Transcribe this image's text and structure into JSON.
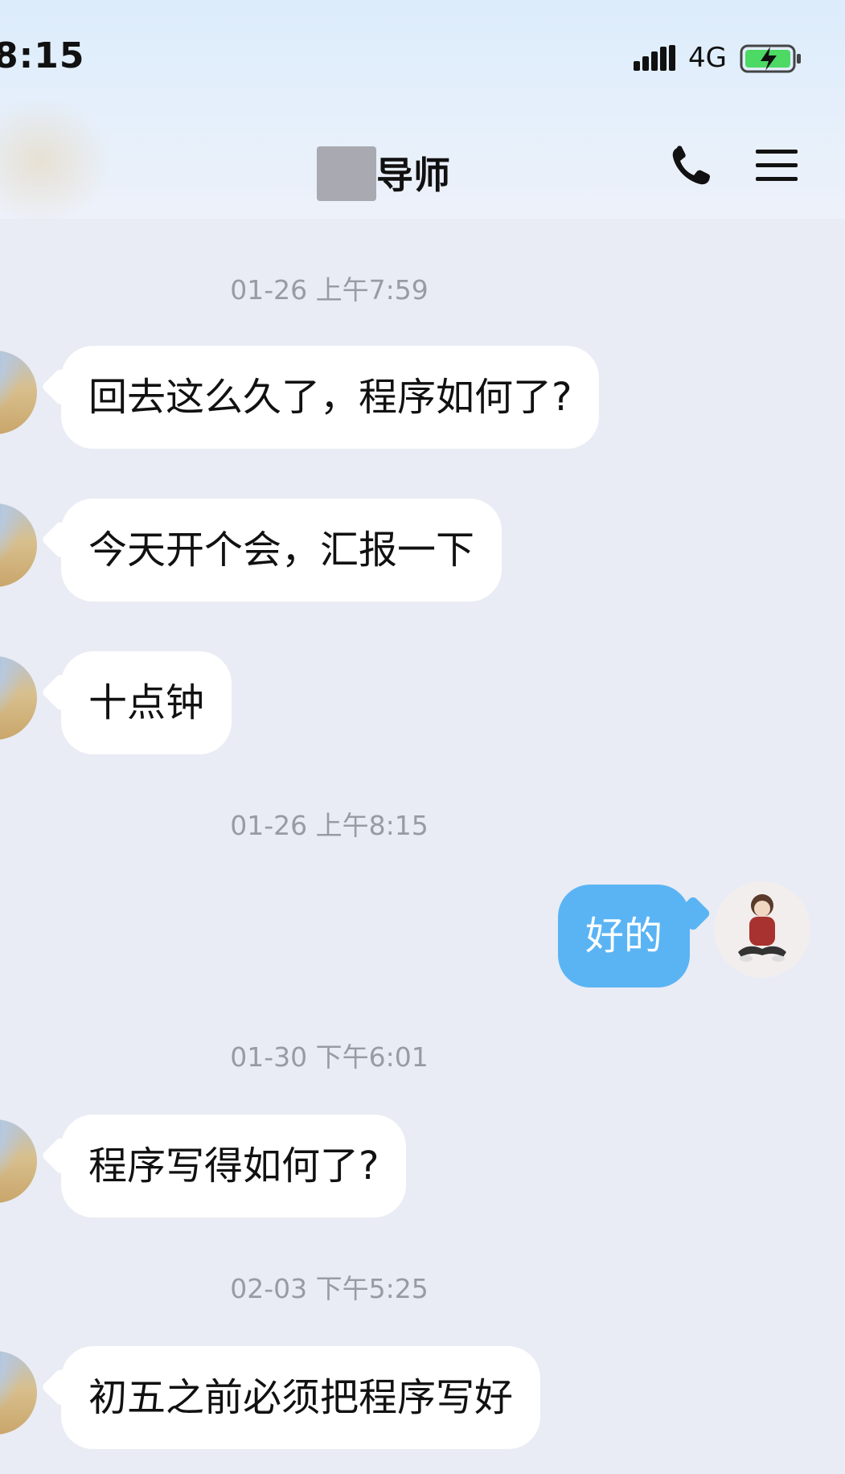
{
  "status_bar": {
    "time": "8:15",
    "network": "4G",
    "signal_icon": "signal-bars-icon",
    "battery_icon": "battery-charging-icon"
  },
  "header": {
    "title": "导师",
    "call_icon": "phone-icon",
    "menu_icon": "hamburger-menu-icon"
  },
  "timestamps": [
    "01-26 上午7:59",
    "01-26 上午8:15",
    "01-30 下午6:01",
    "02-03 下午5:25"
  ],
  "messages": [
    {
      "direction": "incoming",
      "text": "回去这么久了，程序如何了?"
    },
    {
      "direction": "incoming",
      "text": "今天开个会，汇报一下"
    },
    {
      "direction": "incoming",
      "text": "十点钟"
    },
    {
      "direction": "outgoing",
      "text": "好的"
    },
    {
      "direction": "incoming",
      "text": "程序写得如何了?"
    },
    {
      "direction": "incoming",
      "text": "初五之前必须把程序写好"
    }
  ],
  "colors": {
    "background": "#e9ecf4",
    "incoming_bubble": "#ffffff",
    "outgoing_bubble": "#5ab4f4",
    "timestamp_text": "#999ba3",
    "battery_fill": "#4cd964"
  }
}
